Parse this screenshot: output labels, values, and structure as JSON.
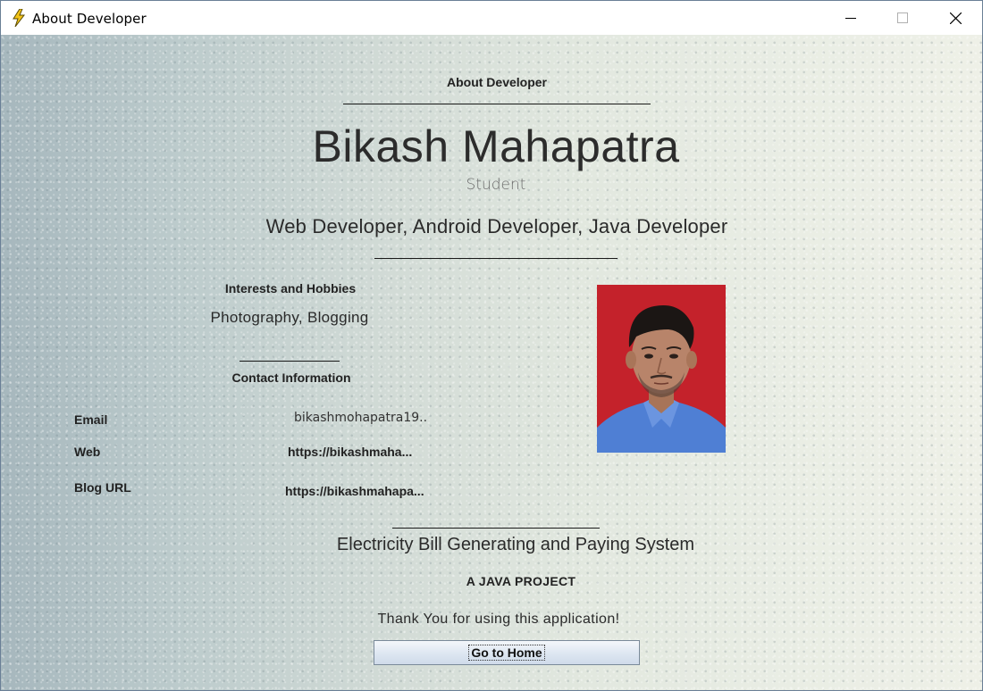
{
  "window": {
    "title": "About Developer",
    "controls": [
      "minimize-icon",
      "maximize-icon",
      "close-icon"
    ]
  },
  "header": {
    "heading": "About Developer",
    "name": "Bikash Mahapatra",
    "role": "Student",
    "skills": "Web Developer, Android Developer, Java Developer"
  },
  "interests": {
    "heading": "Interests and Hobbies",
    "value": "Photography, Blogging"
  },
  "contact": {
    "heading": "Contact Information",
    "email_label": "Email",
    "email_value": "bikashmohapatra19..",
    "web_label": "Web",
    "web_value": "https://bikashmaha...",
    "blog_label": "Blog URL",
    "blog_value": "https://bikashmahapa..."
  },
  "project": {
    "title": "Electricity Bill Generating and Paying System",
    "subtitle": "A JAVA PROJECT",
    "thanks": "Thank You for using this application!"
  },
  "button": {
    "home_label": "Go to Home"
  },
  "colors": {
    "photo_background": "#c4222b",
    "shirt": "#4f7fd4",
    "button_gradient_top": "#f4f7fb",
    "button_gradient_bottom": "#cfdbea"
  },
  "icons": {
    "app": "lightning-bolt-icon"
  }
}
